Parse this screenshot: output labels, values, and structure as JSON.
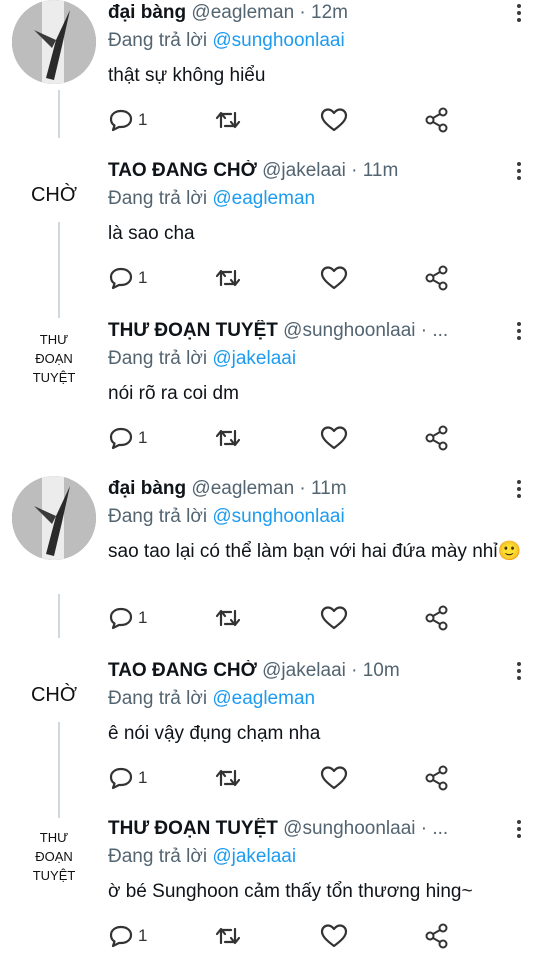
{
  "reply_prefix": "Đang trả lời",
  "tweets": [
    {
      "avatar_text": "",
      "name": "đại bàng",
      "handle": "@eagleman · 12m",
      "reply_to": "@sunghoonlaai",
      "text": "thật sự không hiểu",
      "reply_count": "1"
    },
    {
      "avatar_text": "CHỜ",
      "name": "TAO ĐANG CHỜ",
      "handle": "@jakelaai · 11m",
      "reply_to": "@eagleman",
      "text": "là sao cha",
      "reply_count": "1"
    },
    {
      "avatar_text": "THƯ\nĐOẠN\nTUYỆT",
      "name": "THƯ ĐOẠN TUYỆT",
      "handle": "@sunghoonlaai · ...",
      "reply_to": "@jakelaai",
      "text": "nói rõ ra coi dm",
      "reply_count": "1"
    },
    {
      "avatar_text": "",
      "name": "đại bàng",
      "handle": "@eagleman · 11m",
      "reply_to": "@sunghoonlaai",
      "text": "sao tao lại có thể làm bạn với hai đứa mày nhỉ🙂",
      "reply_count": "1"
    },
    {
      "avatar_text": "CHỜ",
      "name": "TAO ĐANG CHỜ",
      "handle": "@jakelaai · 10m",
      "reply_to": "@eagleman",
      "text": "ê nói vậy đụng chạm nha",
      "reply_count": "1"
    },
    {
      "avatar_text": "THƯ\nĐOẠN\nTUYỆT",
      "name": "THƯ ĐOẠN TUYỆT",
      "handle": "@sunghoonlaai · ...",
      "reply_to": "@jakelaai",
      "text": "ờ bé Sunghoon cảm thấy tổn thương hing~",
      "reply_count": "1"
    }
  ],
  "icons": {
    "reply": "reply-icon",
    "retweet": "retweet-icon",
    "like": "heart-icon",
    "share": "share-icon",
    "more": "more-vertical-icon"
  },
  "colors": {
    "mention": "#1d9bf0",
    "secondary": "#536471",
    "thread_line": "#cfd9de"
  }
}
